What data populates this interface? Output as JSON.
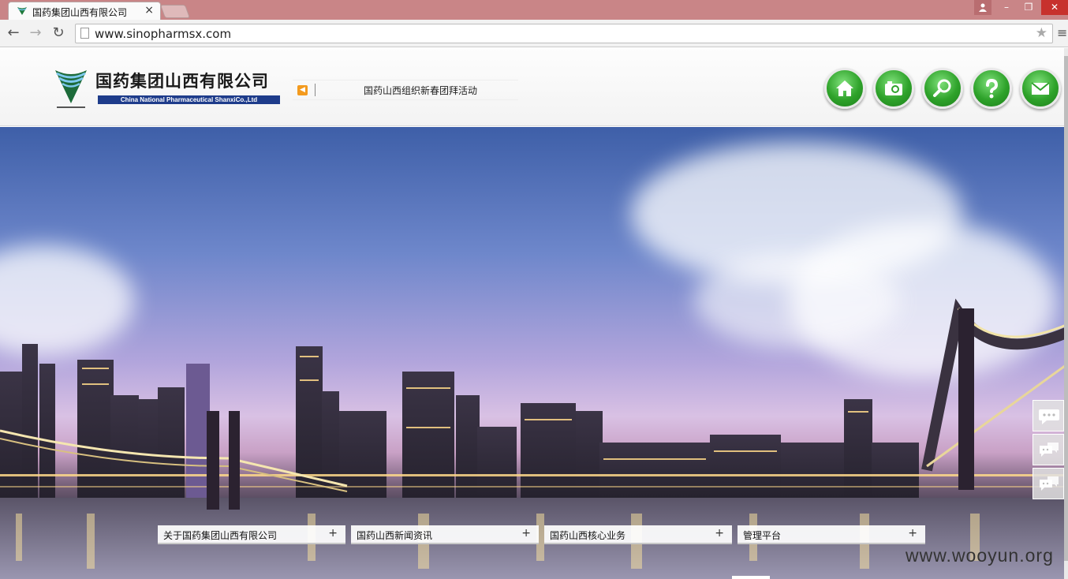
{
  "browser": {
    "tab_title": "国药集团山西有限公司",
    "tab_close": "×",
    "url": "www.sinopharmsx.com",
    "window_controls": {
      "minimize": "–",
      "maximize": "❐",
      "close": "✕"
    },
    "nav": {
      "back": "←",
      "forward": "→",
      "reload": "↻",
      "star": "★",
      "menu": "≡"
    }
  },
  "header": {
    "company_name_cn": "国药集团山西有限公司",
    "company_name_en": "China National Pharmaceutical ShanxiCo.,Ltd",
    "ticker_text": "国药山西组织新春团拜活动",
    "icon_buttons": [
      "home-icon",
      "camera-icon",
      "search-icon",
      "help-icon",
      "mail-icon"
    ]
  },
  "banner": {
    "menus": [
      {
        "label": "关于国药集团山西有限公司",
        "plus": "+"
      },
      {
        "label": "国药山西新闻资讯",
        "plus": "+"
      },
      {
        "label": "国药山西核心业务",
        "plus": "+"
      },
      {
        "label": "管理平台",
        "plus": "+"
      }
    ],
    "side_buttons": [
      "chat-icon",
      "qq-icon",
      "qq-icon"
    ],
    "watermark": "www.wooyun.org"
  },
  "colors": {
    "tab_strip": "#c98587",
    "icon_green": "#2ea22a",
    "logo_blue": "#1e3c8b",
    "close_red": "#c7312d"
  }
}
